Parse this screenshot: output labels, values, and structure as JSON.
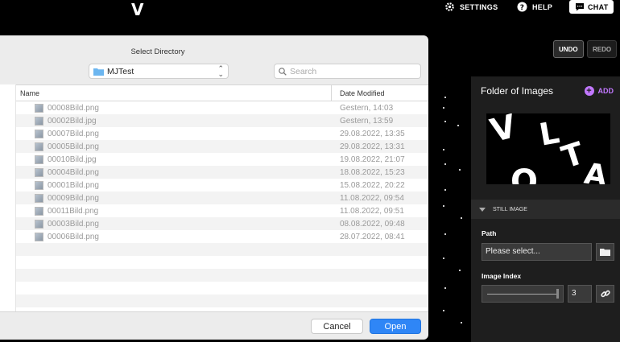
{
  "app": {
    "logo": "V",
    "settings_label": "SETTINGS",
    "help_label": "HELP",
    "chat_label": "CHAT",
    "undo_label": "UNDO",
    "redo_label": "REDO"
  },
  "panel": {
    "title": "Folder of Images",
    "add_label": "ADD",
    "section_label": "STILL IMAGE",
    "path_label": "Path",
    "path_value": "Please select...",
    "image_index_label": "Image Index",
    "image_index_value": "3",
    "slider_level": 1.0,
    "thumbnail_letters": [
      "V",
      "L",
      "T",
      "O",
      "A"
    ],
    "accent_color": "#c278ff"
  },
  "dialog": {
    "title": "Select Directory",
    "location": "MJTest",
    "search_placeholder": "Search",
    "col_name": "Name",
    "col_date": "Date Modified",
    "cancel_label": "Cancel",
    "open_label": "Open",
    "open_color": "#2f86f6",
    "files": [
      {
        "name": "00008Bild.png",
        "date": "Gestern, 14:03"
      },
      {
        "name": "00002Bild.jpg",
        "date": "Gestern, 13:59"
      },
      {
        "name": "00007Bild.png",
        "date": "29.08.2022, 13:35"
      },
      {
        "name": "00005Bild.png",
        "date": "29.08.2022, 13:31"
      },
      {
        "name": "00010Bild.jpg",
        "date": "19.08.2022, 21:07"
      },
      {
        "name": "00004Bild.png",
        "date": "18.08.2022, 15:23"
      },
      {
        "name": "00001Bild.png",
        "date": "15.08.2022, 20:22"
      },
      {
        "name": "00009Bild.png",
        "date": "11.08.2022, 09:54"
      },
      {
        "name": "00011Bild.png",
        "date": "11.08.2022, 09:51"
      },
      {
        "name": "00003Bild.png",
        "date": "08.08.2022, 09:48"
      },
      {
        "name": "00006Bild.png",
        "date": "28.07.2022, 08:41"
      }
    ]
  }
}
